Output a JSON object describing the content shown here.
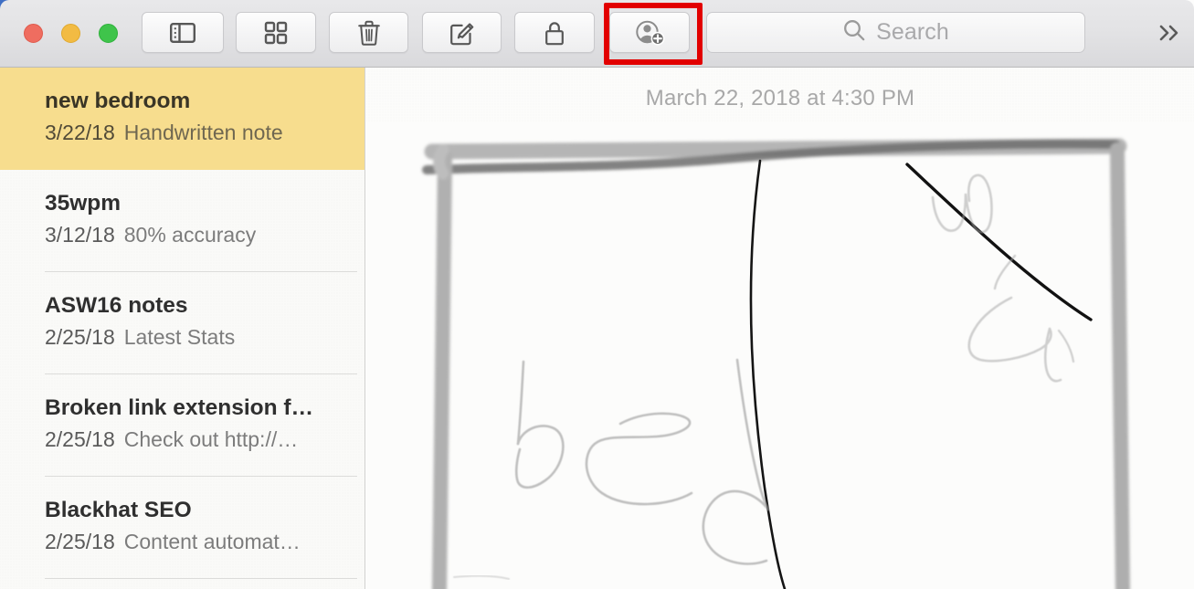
{
  "window": {
    "traffic_lights": [
      {
        "name": "close",
        "color": "#ef6d60"
      },
      {
        "name": "minimize",
        "color": "#f2bb43"
      },
      {
        "name": "maximize",
        "color": "#3fc44b"
      }
    ]
  },
  "toolbar": {
    "buttons": [
      {
        "icon": "sidebar-toggle-icon",
        "label": "Show Folders"
      },
      {
        "icon": "grid-view-icon",
        "label": "Gallery View"
      },
      {
        "icon": "trash-icon",
        "label": "Delete Note"
      },
      {
        "icon": "compose-icon",
        "label": "New Note"
      },
      {
        "icon": "lock-icon",
        "label": "Lock Note"
      },
      {
        "icon": "add-person-icon",
        "label": "Add People"
      }
    ],
    "overflow_label": "»",
    "highlight_color": "#e20000",
    "highlighted_button": "add-person-icon"
  },
  "search": {
    "placeholder": "Search",
    "value": "",
    "icon": "search-icon"
  },
  "sidebar": {
    "selected_index": 0,
    "selection_color": "#f7dd8e",
    "notes": [
      {
        "title": "new bedroom",
        "date": "3/22/18",
        "snippet": "Handwritten note"
      },
      {
        "title": "35wpm",
        "date": "3/12/18",
        "snippet": "80% accuracy"
      },
      {
        "title": "ASW16 notes",
        "date": "2/25/18",
        "snippet": "Latest Stats"
      },
      {
        "title": "Broken link extension f…",
        "date": "2/25/18",
        "snippet": "Check out http://…"
      },
      {
        "title": "Blackhat SEO",
        "date": "2/25/18",
        "snippet": "Content automat…"
      }
    ]
  },
  "note": {
    "timestamp": "March 22, 2018 at 4:30 PM",
    "content_type": "handwritten-sketch",
    "description": "Hand-drawn rectangle outline of a bed with the pencil word 'bed' written below and a scribbled 'w/' annotation in the upper right"
  }
}
